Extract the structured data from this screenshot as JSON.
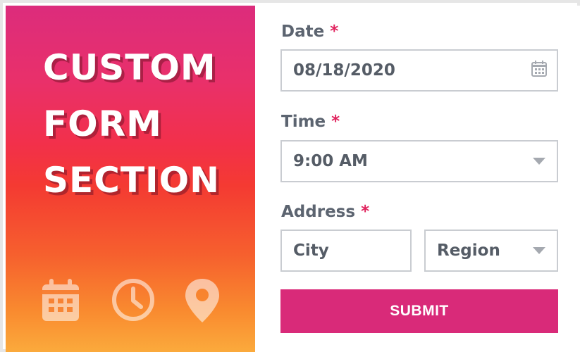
{
  "hero": {
    "title_lines": [
      "CUSTOM",
      "FORM",
      "SECTION"
    ],
    "icons": [
      "calendar-icon",
      "clock-icon",
      "location-pin-icon"
    ]
  },
  "form": {
    "date": {
      "label": "Date",
      "required_mark": "*",
      "value": "08/18/2020",
      "icon": "calendar-icon"
    },
    "time": {
      "label": "Time",
      "required_mark": "*",
      "value": "9:00 AM",
      "icon": "chevron-down-icon"
    },
    "address": {
      "label": "Address",
      "required_mark": "*",
      "city_placeholder": "City",
      "region_value": "Region"
    },
    "submit_label": "SUBMIT"
  },
  "colors": {
    "accent": "#d92a79",
    "required": "#e0245e",
    "text": "#5c6470",
    "border": "#c9ccd1",
    "gradient_top": "#dc2c7c",
    "gradient_bottom": "#fbaa3c"
  }
}
